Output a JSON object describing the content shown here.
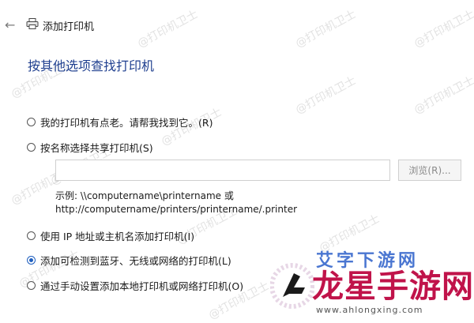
{
  "window": {
    "title": "添加打印机"
  },
  "heading": "按其他选项查找打印机",
  "options": [
    {
      "label": "我的打印机有点老。请帮我找到它。(R)",
      "checked": false
    },
    {
      "label": "按名称选择共享打印机(S)",
      "checked": false
    },
    {
      "label": "使用 IP 地址或主机名添加打印机(I)",
      "checked": false
    },
    {
      "label": "添加可检测到蓝牙、无线或网络的打印机(L)",
      "checked": true
    },
    {
      "label": "通过手动设置添加本地打印机或网络打印机(O)",
      "checked": false
    }
  ],
  "share": {
    "value": "",
    "browse_label": "浏览(R)..."
  },
  "example": {
    "line1": "示例: \\\\computername\\printername 或",
    "line2": "http://computername/printers/printername/.printer"
  },
  "watermark": {
    "text": "@打印机卫士"
  },
  "logo": {
    "top_text": "艾字下游网",
    "main_text": "龙星手游网",
    "url": "www.ahlongxing.com"
  },
  "icons": {
    "back": "back-arrow-icon",
    "printer": "printer-icon"
  }
}
